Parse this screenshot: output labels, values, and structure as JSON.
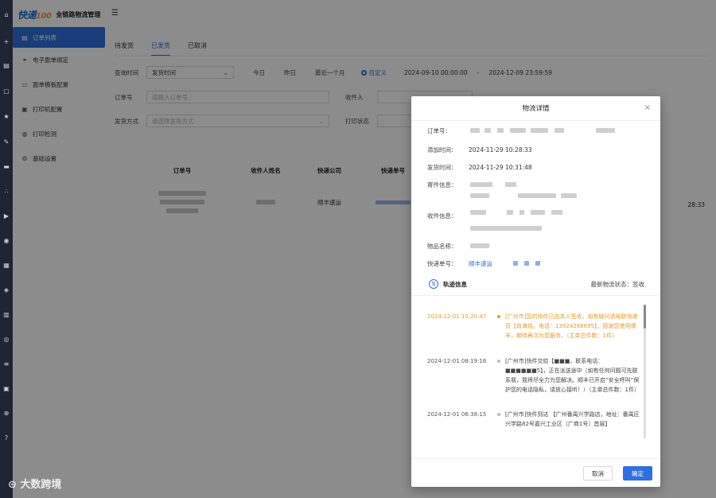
{
  "brand": {
    "logo_text": "快递",
    "logo_num": "100",
    "name": "全链路物流管理"
  },
  "sidebar": {
    "items": [
      {
        "label": "订单列表",
        "icon": "list-icon",
        "active": true
      },
      {
        "label": "电子面单绑定",
        "icon": "link-icon"
      },
      {
        "label": "面单模板配置",
        "icon": "template-icon"
      },
      {
        "label": "打印机配置",
        "icon": "printer-icon"
      },
      {
        "label": "打印检测",
        "icon": "check-icon"
      },
      {
        "label": "基础设置",
        "icon": "settings-icon"
      }
    ]
  },
  "tabs": [
    "待发货",
    "已发货",
    "已取消"
  ],
  "filters": {
    "query_time_label": "查询时间",
    "query_time_value": "发货时间",
    "today": "今日",
    "yesterday": "昨日",
    "last_month": "最近一个月",
    "custom": "自定义",
    "start": "2024-09-10 00:00:00",
    "dash": "-",
    "end": "2024-12-09 23:59:59",
    "order_label": "订单号",
    "order_placeholder": "请输入订单号",
    "receiver_label": "收件人",
    "ship_label": "发货方式",
    "ship_placeholder": "请选择发货方式",
    "print_label": "打印状态"
  },
  "table": {
    "headers": [
      "订单号",
      "收件人姓名",
      "快递公司",
      "快递单号"
    ],
    "row": {
      "company": "顺丰速运",
      "time_fragment": "28:33"
    }
  },
  "modal": {
    "title": "物流详情",
    "close": "×",
    "order_no_label": "订单号：",
    "add_time_label": "添加时间：",
    "add_time": "2024-11-29 10:28:33",
    "ship_time_label": "发货时间：",
    "ship_time": "2024-11-29 10:31:48",
    "sender_label": "寄件信息：",
    "receiver_label": "收件信息：",
    "goods_label": "物品名称：",
    "tracking_label": "快递单号：",
    "tracking_company": "顺丰速运",
    "track_title": "轨迹信息",
    "latest_status": "最新物流状态：签收",
    "events": [
      {
        "time": "2024-12-01 10:20:47",
        "text": "[广州市]您的快件已由本人签收，如有疑问请电联快递员【肖海铭，电话：13924288695】，感谢您使用顺丰，期待再次为您服务。（主单总件数：1件）"
      },
      {
        "time": "2024-12-01 08:19:16",
        "text": "[广州市]快件交给【■■■，联系电话：■■■■■■5】，正在派送途中（如有任何问题可先联系我，我将尽全力为您解决。顺丰已开启“安全呼叫”保护您的电话隐私，请放心接听！）（主单总件数：1件）"
      },
      {
        "time": "2024-12-01 06:38:15",
        "text": "[广州市]快件到达 【广州番禺兴学路店，地址：番禺区兴学路82号嘉兴工业区（广商1号）首层】"
      }
    ],
    "cancel": "取消",
    "ok": "确定"
  },
  "footer_logo": "大数跨境"
}
